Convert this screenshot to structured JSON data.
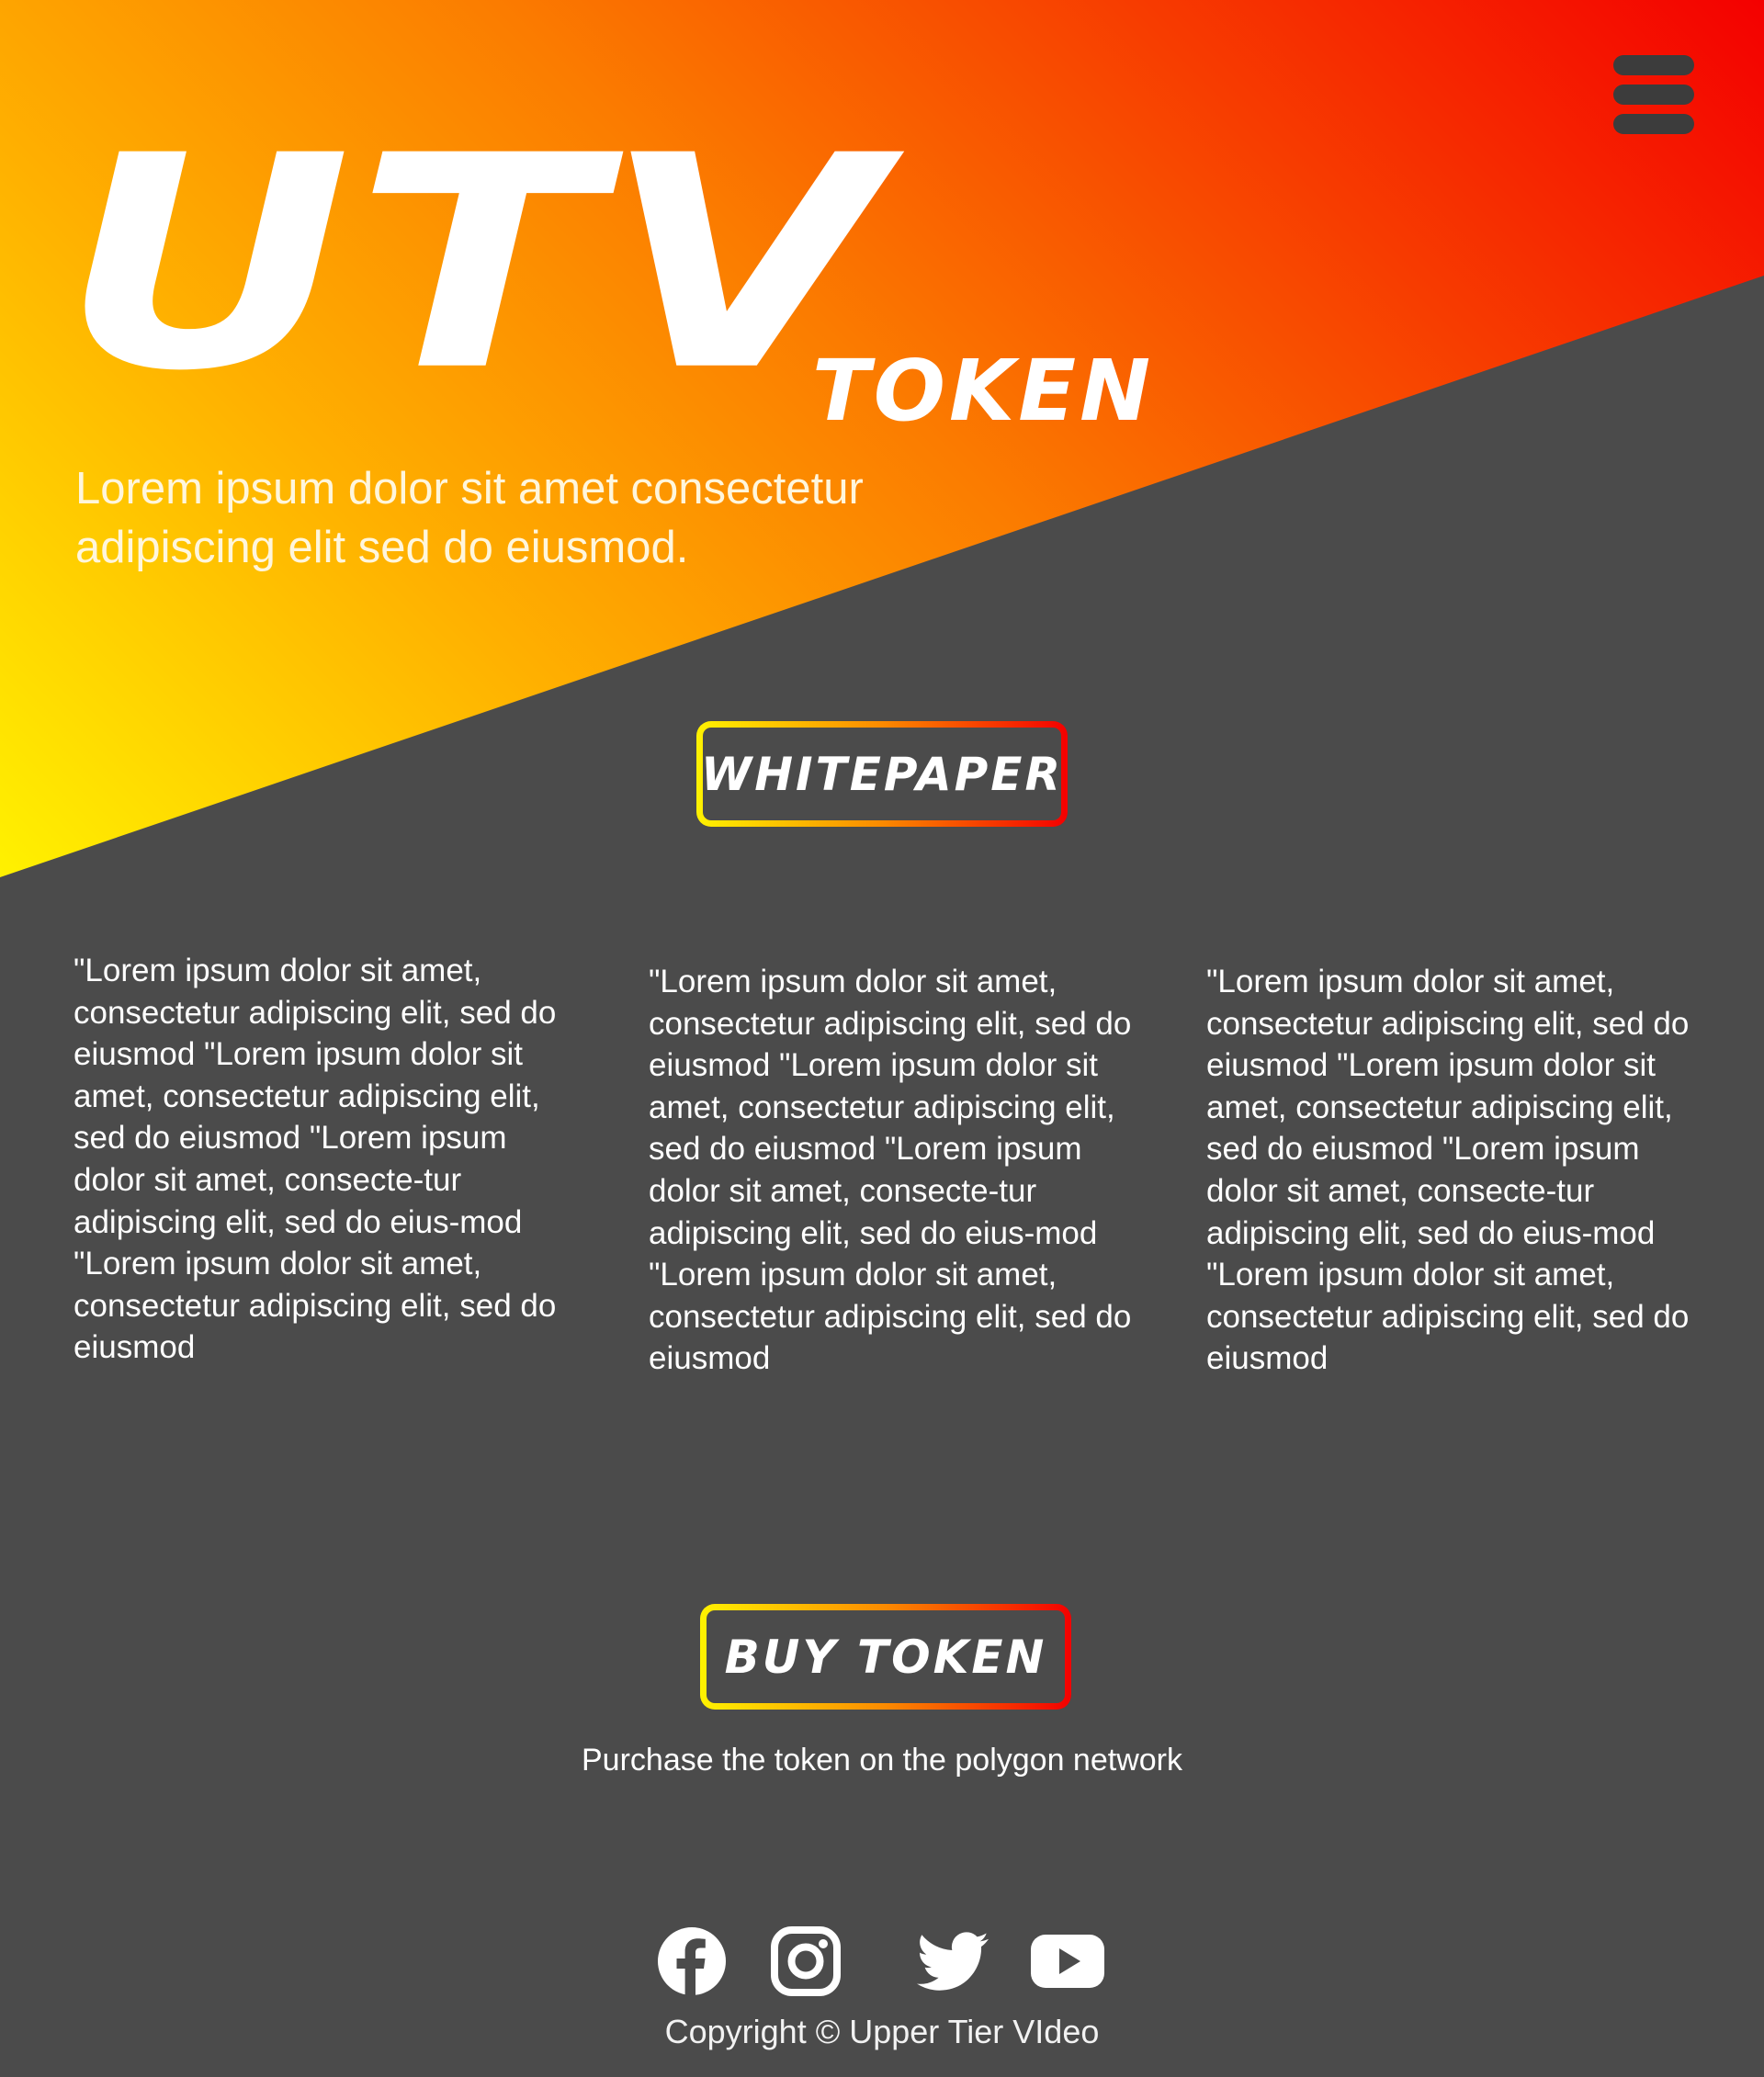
{
  "hero": {
    "logo_main": "UTV",
    "logo_sub": "TOKEN",
    "tagline": "Lorem ipsum dolor sit amet consectetur adipiscing elit sed do eiusmod."
  },
  "buttons": {
    "whitepaper": "WHITEPAPER",
    "buy_token": "BUY TOKEN"
  },
  "columns": [
    {
      "text": "\"Lorem ipsum dolor sit amet, consectetur adipiscing elit, sed do eiusmod \"Lorem ipsum dolor sit amet, consectetur adipiscing elit, sed do eiusmod \"Lorem ipsum dolor sit amet, consecte-tur adipiscing elit, sed do eius-mod \"Lorem ipsum dolor sit amet, consectetur adipiscing elit, sed do eiusmod"
    },
    {
      "text": "\"Lorem ipsum dolor sit amet, consectetur adipiscing elit, sed do eiusmod \"Lorem ipsum dolor sit amet, consectetur adipiscing elit, sed do eiusmod \"Lorem ipsum dolor sit amet, consecte-tur adipiscing elit, sed do eius-mod \"Lorem ipsum dolor sit amet, consectetur adipiscing elit, sed do eiusmod"
    },
    {
      "text": "\"Lorem ipsum dolor sit amet, consectetur adipiscing elit, sed do eiusmod \"Lorem ipsum dolor sit amet, consectetur adipiscing elit, sed do eiusmod \"Lorem ipsum dolor sit amet, consecte-tur adipiscing elit, sed do eius-mod \"Lorem ipsum dolor sit amet, consectetur adipiscing elit, sed do eiusmod"
    }
  ],
  "purchase_note": "Purchase the token on the polygon network",
  "socials": [
    {
      "icon": "facebook-icon"
    },
    {
      "icon": "instagram-icon"
    },
    {
      "icon": "twitter-icon"
    },
    {
      "icon": "youtube-icon"
    }
  ],
  "copyright": "Copyright © Upper Tier VIdeo",
  "colors": {
    "background": "#4b4b4b",
    "gradient_start": "#fff200",
    "gradient_mid": "#fb7c00",
    "gradient_end": "#f40000",
    "menu_icon": "#3c3c3c",
    "text": "#ffffff"
  }
}
